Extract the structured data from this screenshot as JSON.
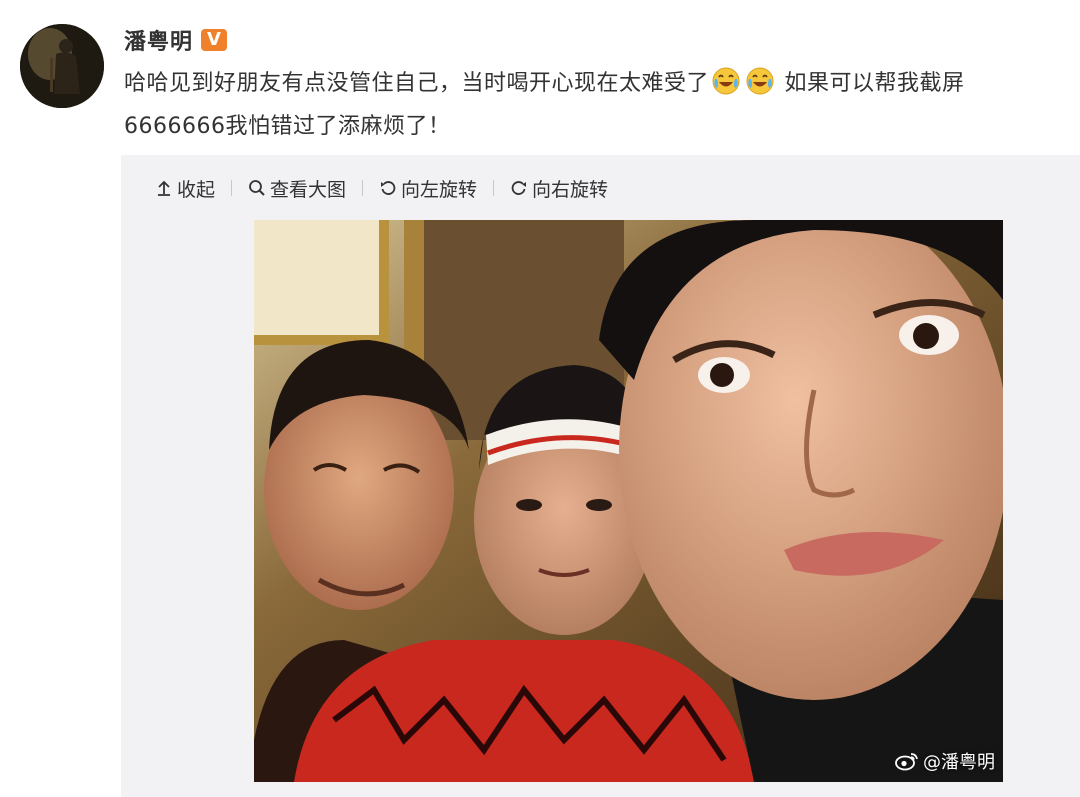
{
  "user": {
    "name": "潘粤明",
    "verified_badge": "V"
  },
  "post": {
    "text_part1": "哈哈见到好朋友有点没管住自己，当时喝开心现在太难受了",
    "text_part2": " 如果可以帮我截屏6666666我怕错过了添麻烦了！",
    "emoji_icons": [
      "crying-laughing-emoji-icon",
      "crying-laughing-emoji-icon"
    ]
  },
  "toolbar": {
    "collapse_label": "收起",
    "view_large_label": "查看大图",
    "rotate_left_label": "向左旋转",
    "rotate_right_label": "向右旋转"
  },
  "photo": {
    "watermark_text": "@潘粤明"
  },
  "colors": {
    "badge": "#f0812a",
    "media_bg": "#f2f2f5",
    "text": "#333333"
  }
}
